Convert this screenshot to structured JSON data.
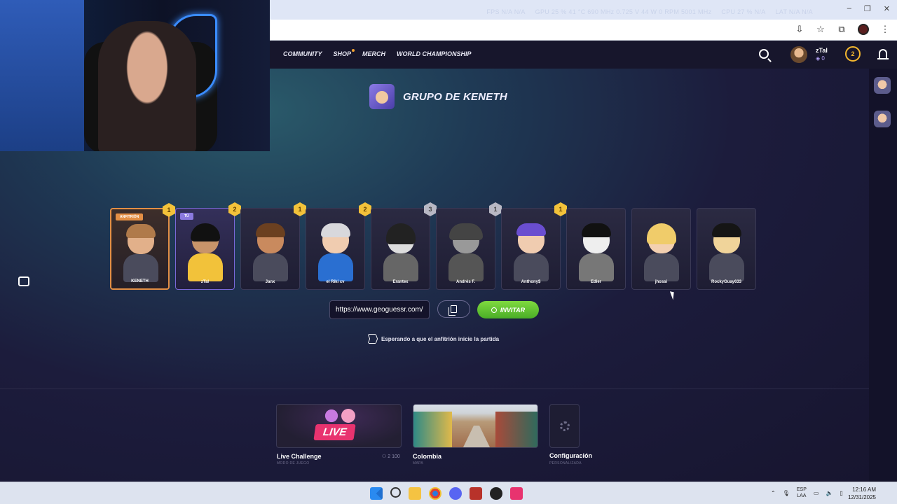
{
  "overlay": {
    "fps": "FPS  N/A  N/A",
    "gpu": "GPU  25 %  41 °C  690 MHz  0.725 V  44 W  0 RPM  5001 MHz",
    "cpu": "CPU  27 %  N/A",
    "lat": "LAT  N/A  N/A"
  },
  "nav": {
    "links": [
      "COMMUNITY",
      "SHOP",
      "MERCH",
      "WORLD CHAMPIONSHIP"
    ],
    "user_name": "zTal",
    "user_coins": "0",
    "level": "2"
  },
  "group": {
    "title": "GRUPO DE KENETH"
  },
  "players": [
    {
      "name": "KENETH",
      "tag": "ANFITRIÓN",
      "level": "1",
      "role": "host"
    },
    {
      "name": "zTal",
      "tag": "TÚ",
      "level": "2",
      "role": "you"
    },
    {
      "name": "Janx",
      "tag": "",
      "level": "1",
      "role": ""
    },
    {
      "name": "el Riki cv",
      "tag": "",
      "level": "2",
      "role": ""
    },
    {
      "name": "Erantex",
      "tag": "",
      "level": "3",
      "role": ""
    },
    {
      "name": "Andrés F.",
      "tag": "",
      "level": "1",
      "role": ""
    },
    {
      "name": "Anthony$",
      "tag": "",
      "level": "1",
      "role": ""
    },
    {
      "name": "Edier",
      "tag": "",
      "level": "",
      "role": ""
    },
    {
      "name": "jhossi",
      "tag": "",
      "level": "",
      "role": ""
    },
    {
      "name": "RockyGuay633",
      "tag": "",
      "level": "",
      "role": ""
    }
  ],
  "invite": {
    "url": "https://www.geoguessr.com/",
    "button_label": "INVITAR"
  },
  "status": {
    "waiting": "Esperando a que el anfitrión inicie la partida"
  },
  "settings": {
    "mode_badge": "LIVE",
    "mode_title": "Live Challenge",
    "mode_sub": "MODO DE JUEGO",
    "players_count": "2 100",
    "map_title": "Colombia",
    "map_sub": "MAPA",
    "config_title": "Configuración",
    "config_sub": "PERSONALIZADA"
  },
  "taskbar": {
    "lang_1": "ESP",
    "lang_2": "LAA",
    "time": "12:16 AM",
    "date": "12/31/2025"
  }
}
